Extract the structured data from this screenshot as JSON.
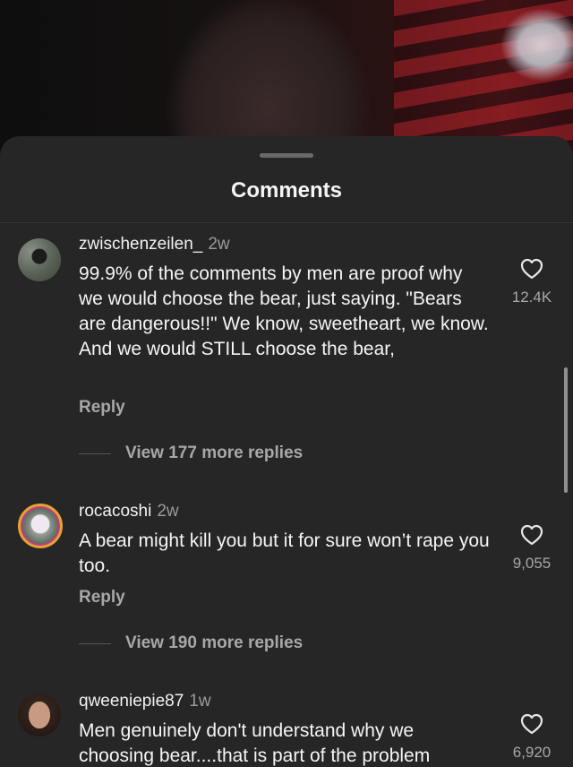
{
  "sheet": {
    "title": "Comments"
  },
  "comments": [
    {
      "username": "zwischenzeilen_",
      "time": "2w",
      "text": "99.9% of the comments by men are proof why we would choose the bear, just saying. \"Bears are dangerous!!\" We know, sweetheart, we know. And we would STILL choose the bear,",
      "reply_label": "Reply",
      "view_replies": "View 177 more replies",
      "likes": "12.4K",
      "avatar_icon": "profile-photo"
    },
    {
      "username": "rocacoshi",
      "time": "2w",
      "text": "A bear might kill you but it for sure won’t rape you too.",
      "reply_label": "Reply",
      "view_replies": "View 190 more replies",
      "likes": "9,055",
      "avatar_icon": "profile-photo-story-ring"
    },
    {
      "username": "qweeniepie87",
      "time": "1w",
      "text": "Men genuinely don't understand why we choosing bear....that is part of the problem",
      "likes": "6,920",
      "avatar_icon": "profile-photo"
    }
  ],
  "icons": {
    "like": "heart-outline-icon",
    "grabber": "drag-handle"
  },
  "colors": {
    "sheet_bg": "#262626",
    "text_primary": "#f5f5f5",
    "text_secondary": "#a8a8a8",
    "story_ring": "#e7a22f"
  }
}
